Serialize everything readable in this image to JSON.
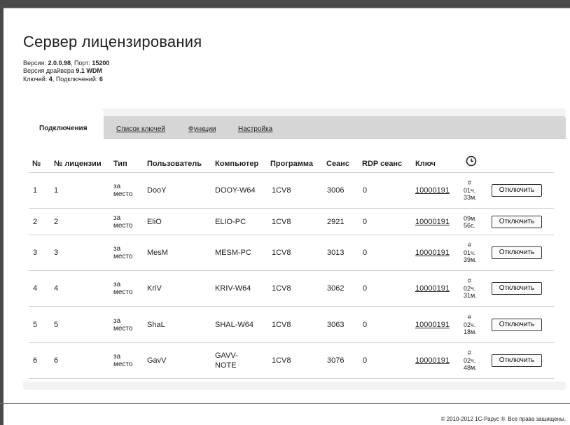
{
  "page": {
    "title": "Сервер лицензирования",
    "version_label": "Версия:",
    "version": "2.0.0.98",
    "port_label": ", Порт:",
    "port": "15200",
    "driver_label": "Версия драйвера",
    "driver": "9.1 WDM",
    "keys_label": "Ключей:",
    "keys": "4",
    "connections_label": ", Подключений:",
    "connections": "6"
  },
  "tabs": [
    {
      "label": "Подключения",
      "active": true
    },
    {
      "label": "Список ключей"
    },
    {
      "label": "Функции"
    },
    {
      "label": "Настройка"
    }
  ],
  "table": {
    "headers": [
      "№",
      "№ лицензии",
      "Тип",
      "Пользователь",
      "Компьютер",
      "Программа",
      "Сеанс",
      "RDP сеанс",
      "Ключ"
    ],
    "clock_icon": "clock-icon",
    "button_label": "Отключить",
    "rows": [
      {
        "n": "1",
        "lic": "1",
        "type1": "за",
        "type2": "место",
        "user": "DooY",
        "comp1": "DOOY-W64",
        "comp2": "",
        "prog": "1CV8",
        "session": "3006",
        "rdp": "0",
        "key": "10000191",
        "t1": "#",
        "t2": "01ч.",
        "t3": "33м."
      },
      {
        "n": "2",
        "lic": "2",
        "type1": "за",
        "type2": "место",
        "user": "EliO",
        "comp1": "ELIO-PC",
        "comp2": "",
        "prog": "1CV8",
        "session": "2921",
        "rdp": "0",
        "key": "10000191",
        "t1": "",
        "t2": "09м.",
        "t3": "56с."
      },
      {
        "n": "3",
        "lic": "3",
        "type1": "за",
        "type2": "место",
        "user": "MesM",
        "comp1": "MESM-PC",
        "comp2": "",
        "prog": "1CV8",
        "session": "3013",
        "rdp": "0",
        "key": "10000191",
        "t1": "#",
        "t2": "01ч.",
        "t3": "39м."
      },
      {
        "n": "4",
        "lic": "4",
        "type1": "за",
        "type2": "место",
        "user": "KriV",
        "comp1": "KRIV-W64",
        "comp2": "",
        "prog": "1CV8",
        "session": "3062",
        "rdp": "0",
        "key": "10000191",
        "t1": "#",
        "t2": "02ч.",
        "t3": "31м."
      },
      {
        "n": "5",
        "lic": "5",
        "type1": "за",
        "type2": "место",
        "user": "ShaL",
        "comp1": "SHAL-W64",
        "comp2": "",
        "prog": "1CV8",
        "session": "3063",
        "rdp": "0",
        "key": "10000191",
        "t1": "#",
        "t2": "02ч.",
        "t3": "18м."
      },
      {
        "n": "6",
        "lic": "6",
        "type1": "за",
        "type2": "место",
        "user": "GavV",
        "comp1": "GAVV-",
        "comp2": "NOTE",
        "prog": "1CV8",
        "session": "3076",
        "rdp": "0",
        "key": "10000191",
        "t1": "#",
        "t2": "02ч.",
        "t3": "48м."
      }
    ]
  },
  "footer": {
    "text": "© 2010-2012 1С-Рарус ®. Все права защищены."
  }
}
